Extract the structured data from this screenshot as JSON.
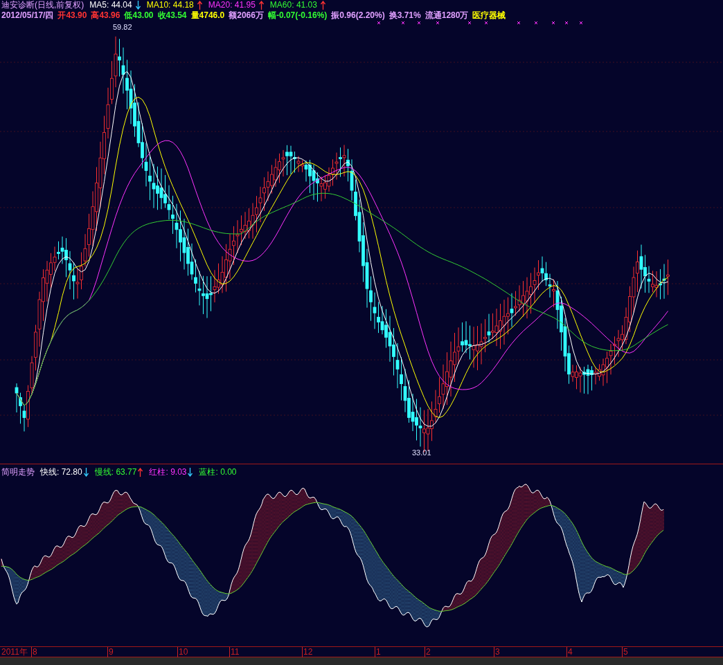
{
  "header": {
    "title": "迪安诊断(日线,前复权)",
    "ma": [
      {
        "label": "MA5:",
        "value": "44.04",
        "rising": false,
        "color": "#ffffff"
      },
      {
        "label": "MA10:",
        "value": "44.18",
        "rising": true,
        "color": "#ffff00"
      },
      {
        "label": "MA20:",
        "value": "41.95",
        "rising": true,
        "color": "#ff33ff"
      },
      {
        "label": "MA60:",
        "value": "41.03",
        "rising": true,
        "color": "#33ff33"
      }
    ]
  },
  "quote": [
    {
      "text": "2012/05/17/四",
      "color": "#e0a0ff"
    },
    {
      "text": "开43.90",
      "color": "#ff3333"
    },
    {
      "text": "高43.96",
      "color": "#ff3333"
    },
    {
      "text": "低43.00",
      "color": "#33ff33"
    },
    {
      "text": "收43.54",
      "color": "#33ff33"
    },
    {
      "text": "量4746.0",
      "color": "#ffff00"
    },
    {
      "text": "额2066万",
      "color": "#e0a0ff"
    },
    {
      "text": "幅-0.07(-0.16%)",
      "color": "#33ff33"
    },
    {
      "text": "振0.96(2.20%)",
      "color": "#e0a0ff"
    },
    {
      "text": "换3.71%",
      "color": "#e0a0ff"
    },
    {
      "text": "流通1280万",
      "color": "#e0a0ff"
    },
    {
      "text": "医疗器械",
      "color": "#ffff00"
    }
  ],
  "price_marks": {
    "high": "59.82",
    "low": "33.01"
  },
  "indicator": {
    "name": "简明走势",
    "items": [
      {
        "label": "快线:",
        "value": "72.80",
        "rising": false,
        "color": "#ffffff"
      },
      {
        "label": "慢线:",
        "value": "63.77",
        "rising": true,
        "color": "#33ff33"
      },
      {
        "label": "红柱:",
        "value": "9.03",
        "rising": false,
        "color": "#ff33ff"
      },
      {
        "label": "蓝柱:",
        "value": "0.00",
        "color": "#33ff33"
      }
    ]
  },
  "axis": {
    "year": "2011年",
    "months": [
      "8",
      "9",
      "10",
      "11",
      "12",
      "1",
      "2",
      "3",
      "4",
      "5"
    ]
  }
}
